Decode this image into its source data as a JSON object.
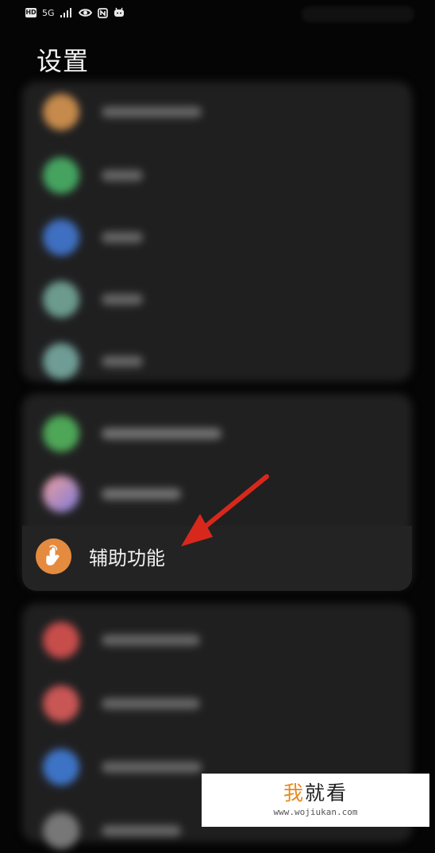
{
  "status_bar": {
    "hd": "HD",
    "network": "5G",
    "icons": [
      "signal-icon",
      "eye-icon",
      "nfc-icon",
      "notification-icon"
    ]
  },
  "header": {
    "title": "设置"
  },
  "focused_item": {
    "label": "辅助功能",
    "icon": "touch-hand-icon",
    "icon_color": "#e58b3f"
  },
  "annotation": {
    "arrow_color": "#d8281c"
  },
  "watermark": {
    "title_prefix": "我",
    "title_rest": "就看",
    "url": "www.wojiukan.com"
  },
  "colors": {
    "background": "#050505",
    "card": "#1f1f20",
    "accent_orange": "#e58b3f"
  }
}
